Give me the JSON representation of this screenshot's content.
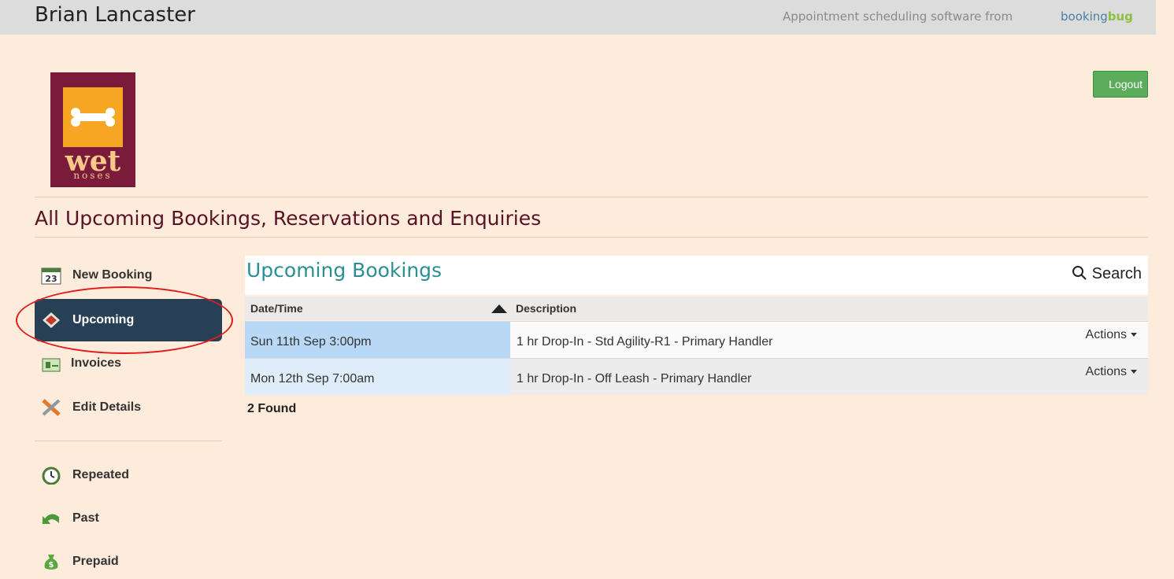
{
  "topbar": {
    "user_name": "Brian Lancaster",
    "tagline": "Appointment scheduling software from",
    "brand_part1": "booking",
    "brand_part2": "bug"
  },
  "logo": {
    "line1": "wet",
    "line2": "noses"
  },
  "logout_label": "Logout",
  "page_title": "All Upcoming Bookings, Reservations and Enquiries",
  "sidebar": {
    "calendar_day": "23",
    "items": [
      {
        "label": "New Booking",
        "icon": "calendar-icon"
      },
      {
        "label": "Upcoming",
        "icon": "upcoming-icon",
        "active": true
      },
      {
        "label": "Invoices",
        "icon": "invoice-icon"
      },
      {
        "label": "Edit Details",
        "icon": "edit-tools-icon"
      },
      {
        "label": "Repeated",
        "icon": "alarm-clock-icon"
      },
      {
        "label": "Past",
        "icon": "undo-arrow-icon"
      },
      {
        "label": "Prepaid",
        "icon": "money-bag-icon"
      }
    ]
  },
  "main": {
    "title": "Upcoming Bookings",
    "search_label": "Search",
    "columns": [
      "Date/Time",
      "Description"
    ],
    "rows": [
      {
        "datetime": "Sun 11th Sep 3:00pm",
        "description": "1 hr Drop-In - Std Agility-R1 - Primary Handler",
        "action": "Actions"
      },
      {
        "datetime": "Mon 12th Sep 7:00am",
        "description": "1 hr Drop-In - Off Leash - Primary Handler",
        "action": "Actions"
      }
    ],
    "found_text": "2 Found"
  },
  "colors": {
    "background": "#fdebdb",
    "nav_active": "#284055",
    "title_teal": "#2a8f94",
    "logout_green": "#5bad5b",
    "highlight_ring": "#e11c1c"
  }
}
